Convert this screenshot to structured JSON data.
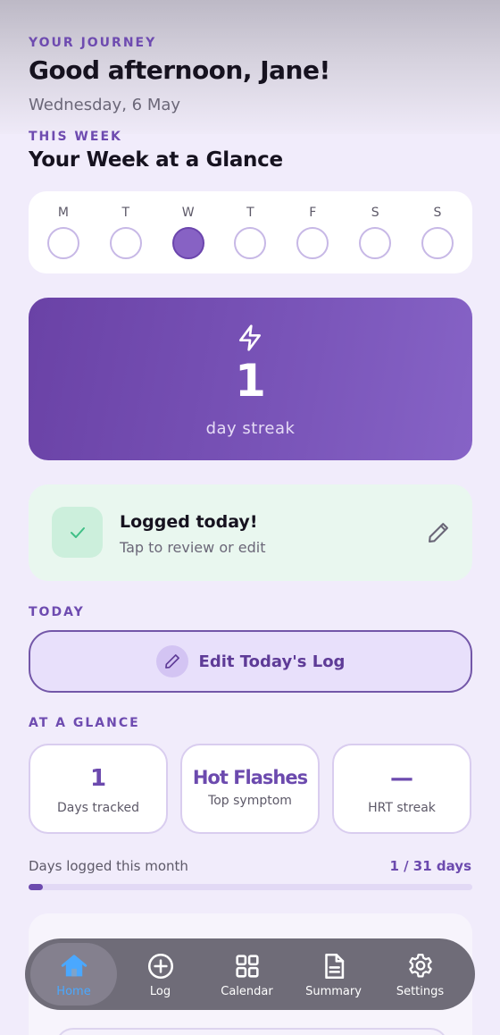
{
  "header": {
    "eyebrow": "YOUR JOURNEY",
    "greeting": "Good afternoon, Jane!",
    "date": "Wednesday, 6 May"
  },
  "week": {
    "eyebrow": "THIS WEEK",
    "title": "Your Week at a Glance",
    "days": [
      {
        "letter": "M",
        "logged": false
      },
      {
        "letter": "T",
        "logged": false
      },
      {
        "letter": "W",
        "logged": true
      },
      {
        "letter": "T",
        "logged": false
      },
      {
        "letter": "F",
        "logged": false
      },
      {
        "letter": "S",
        "logged": false
      },
      {
        "letter": "S",
        "logged": false
      }
    ]
  },
  "streak": {
    "icon": "lightning-icon",
    "value": "1",
    "label": "day streak",
    "gradient_start": "#6a42a6",
    "gradient_end": "#8663c6"
  },
  "logged": {
    "title": "Logged today!",
    "subtitle": "Tap to review or edit",
    "icon": "check-icon",
    "edit_icon": "pencil-icon",
    "color": "#e9f7ef"
  },
  "today": {
    "eyebrow": "TODAY",
    "edit_button": "Edit Today's Log"
  },
  "glance": {
    "eyebrow": "AT A GLANCE",
    "stats": [
      {
        "value": "1",
        "label": "Days tracked"
      },
      {
        "value": "Hot Flashes",
        "label": "Top symptom"
      },
      {
        "value": "—",
        "label": "HRT streak"
      }
    ]
  },
  "month": {
    "label": "Days logged this month",
    "count": "1 / 31 days",
    "progress": 0.032
  },
  "tabbar": {
    "tabs": [
      {
        "label": "Home",
        "icon": "home-icon",
        "active": true
      },
      {
        "label": "Log",
        "icon": "plus-circle-icon",
        "active": false
      },
      {
        "label": "Calendar",
        "icon": "grid-icon",
        "active": false
      },
      {
        "label": "Summary",
        "icon": "document-icon",
        "active": false
      },
      {
        "label": "Settings",
        "icon": "gear-icon",
        "active": false
      }
    ],
    "active_color": "#4aa8ff"
  }
}
